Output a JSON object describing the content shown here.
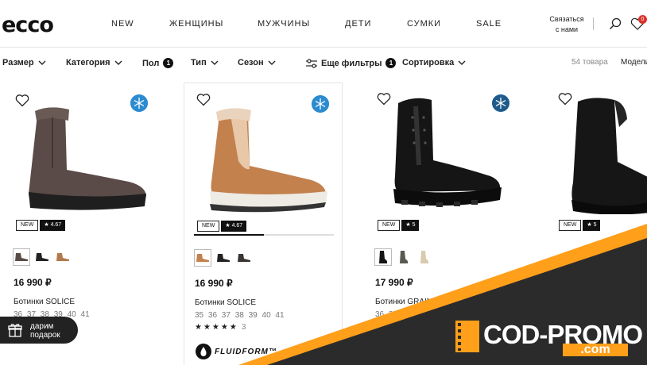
{
  "header": {
    "logo": "ecco",
    "nav": [
      "NEW",
      "ЖЕНЩИНЫ",
      "МУЖЧИНЫ",
      "ДЕТИ",
      "СУМКИ",
      "SALE"
    ],
    "contact_line1": "Связаться",
    "contact_line2": "с нами",
    "wishlist_count": "0"
  },
  "filters": {
    "size": "Размер",
    "category": "Категория",
    "gender": "Пол",
    "gender_count": "1",
    "type": "Тип",
    "season": "Сезон",
    "more": "Еще фильтры",
    "more_count": "1",
    "sort": "Сортировка",
    "product_count": "54 товара",
    "view": "Модели"
  },
  "products": [
    {
      "badge_new": "NEW",
      "rating": "★ 4.67",
      "price": "16 990 ₽",
      "name": "Ботинки SOLICE",
      "sizes": "36 37 38 39 40 41"
    },
    {
      "badge_new": "NEW",
      "rating": "★ 4.67",
      "price": "16 990 ₽",
      "name": "Ботинки SOLICE",
      "sizes": "35 36 37 38 39 40 41",
      "stars": "★★★★★",
      "review_count": "3",
      "tech": "FLUIDFORM™",
      "image_progress": 0.5
    },
    {
      "badge_new": "NEW",
      "rating": "★ 5",
      "price": "17 990 ₽",
      "name": "Ботинки GRAIN",
      "sizes": "36 37 38"
    },
    {
      "badge_new": "NEW",
      "rating": "★ 5"
    }
  ],
  "gift": {
    "line1": "дарим",
    "line2": "подарок"
  },
  "promo": {
    "main": "COD-PROMO",
    "sub": ".com"
  },
  "colors": {
    "accent_blue": "#2a8bd0",
    "promo_orange": "#ff9f1a",
    "promo_dark": "#111111"
  }
}
